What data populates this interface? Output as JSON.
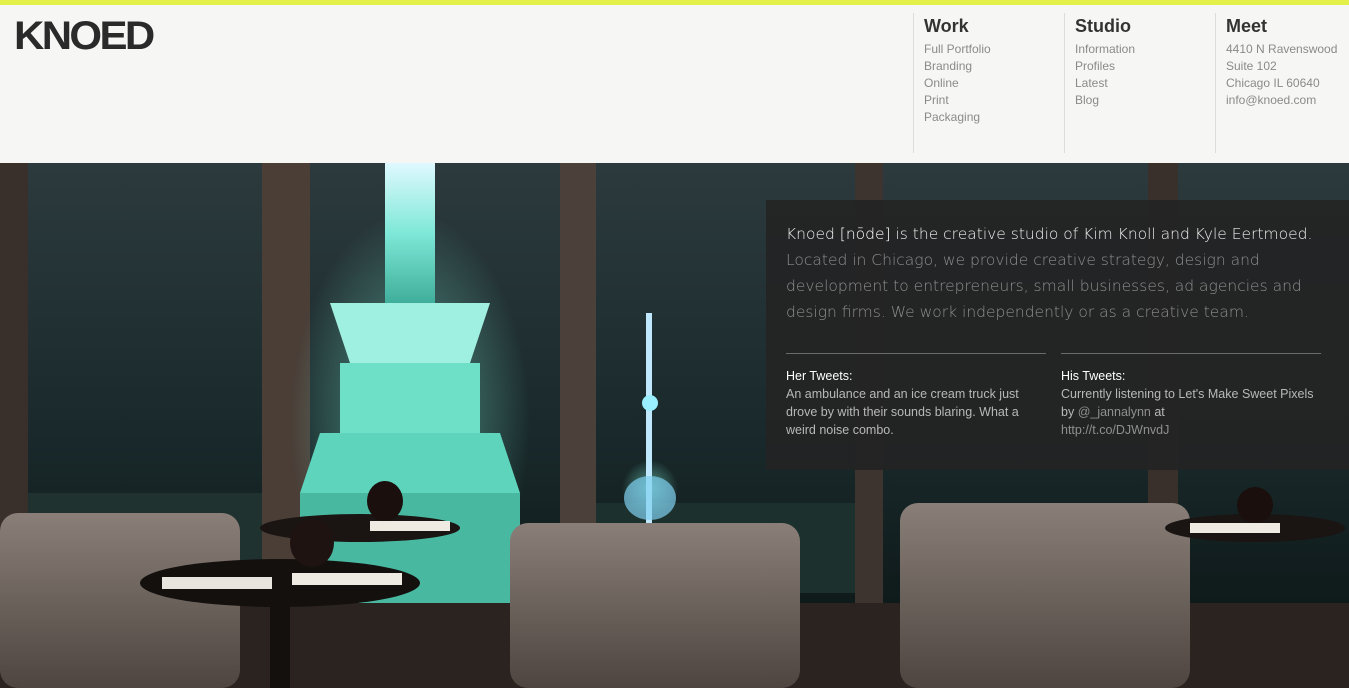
{
  "brand": {
    "logo": "KNOED"
  },
  "nav": {
    "work": {
      "title": "Work",
      "items": [
        "Full Portfolio",
        "Branding",
        "Online",
        "Print",
        "Packaging"
      ]
    },
    "studio": {
      "title": "Studio",
      "items": [
        "Information",
        "Profiles",
        "Latest",
        "Blog"
      ]
    },
    "meet": {
      "title": "Meet",
      "lines": [
        "4410 N Ravenswood",
        "Suite 102",
        "Chicago IL 60640",
        "info@knoed.com"
      ]
    }
  },
  "intro": {
    "lead_before": "Knoed ",
    "phonetic": "[nōde]",
    "lead_after": " is the creative studio of Kim Knoll and Kyle Eertmoed.",
    "body": "Located in Chicago, we provide creative strategy, design and development to entrepreneurs, small businesses, ad agencies and design firms. We work independently or as a creative team."
  },
  "tweets": {
    "her": {
      "heading": "Her Tweets:",
      "text": "An ambulance and an ice cream truck just drove by with their sounds blaring. What a weird noise combo."
    },
    "his": {
      "heading": "His Tweets:",
      "text_before": "Currently listening to Let's Make Sweet Pixels by ",
      "mention": "@_jannalynn",
      "text_mid": " at",
      "link": "http://t.co/DJWnvdJ"
    }
  },
  "colors": {
    "accent": "#e4f04a",
    "header_bg": "#f6f7f5",
    "panel_bg": "#242424"
  }
}
